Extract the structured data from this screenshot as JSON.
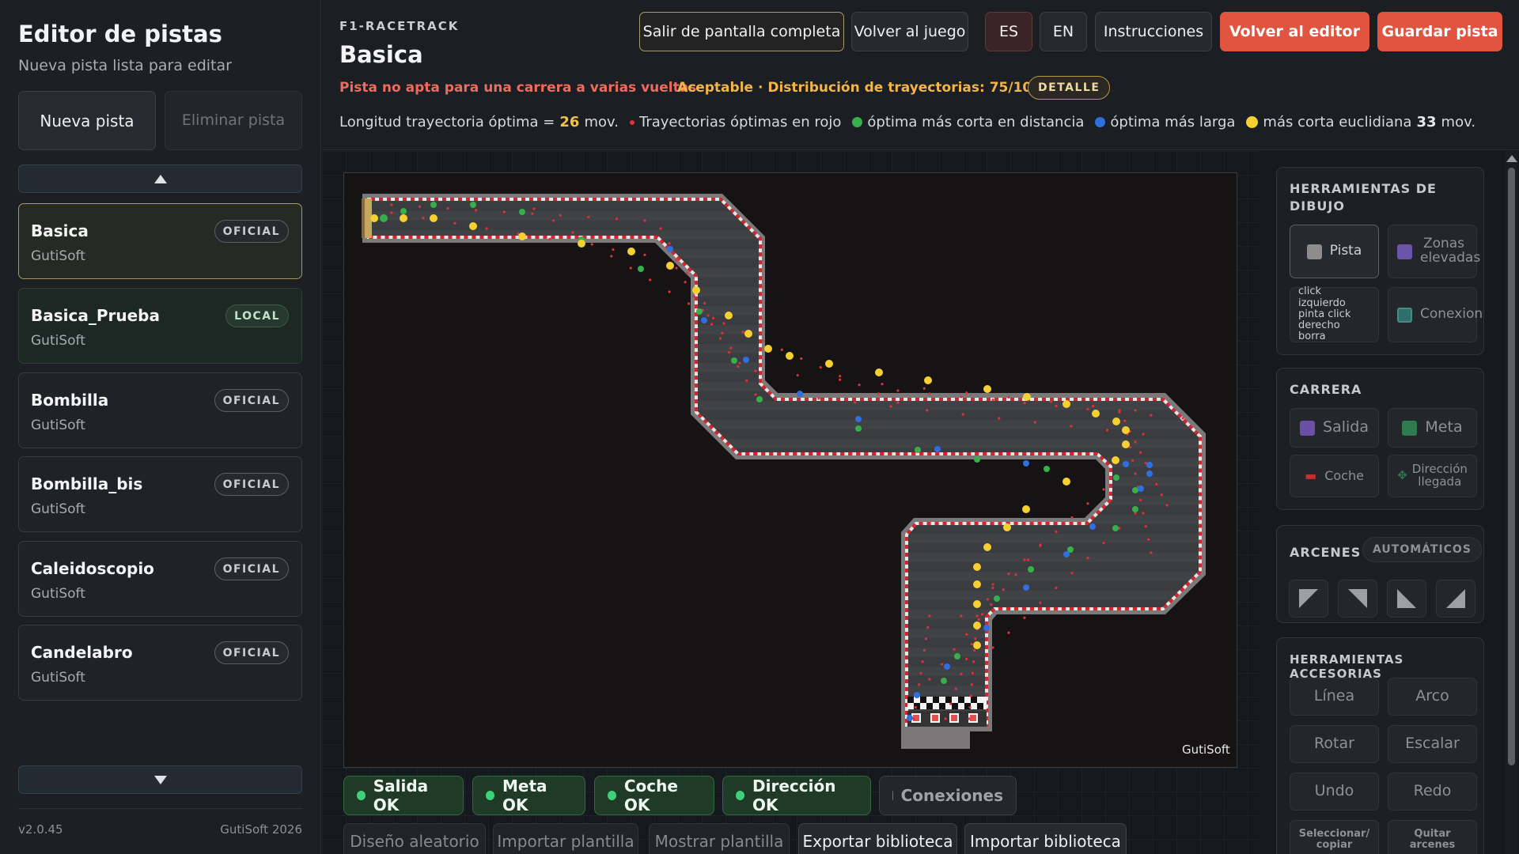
{
  "sidebar": {
    "title": "Editor de pistas",
    "subtitle": "Nueva pista lista para editar",
    "new_label": "Nueva pista",
    "delete_label": "Eliminar pista",
    "tracks": [
      {
        "name": "Basica",
        "author": "GutiSoft",
        "badge": "OFICIAL"
      },
      {
        "name": "Basica_Prueba",
        "author": "GutiSoft",
        "badge": "LOCAL"
      },
      {
        "name": "Bombilla",
        "author": "GutiSoft",
        "badge": "OFICIAL"
      },
      {
        "name": "Bombilla_bis",
        "author": "GutiSoft",
        "badge": "OFICIAL"
      },
      {
        "name": "Caleidoscopio",
        "author": "GutiSoft",
        "badge": "OFICIAL"
      },
      {
        "name": "Candelabro",
        "author": "GutiSoft",
        "badge": "OFICIAL"
      }
    ],
    "version": "v2.0.45",
    "copyright": "GutiSoft 2026"
  },
  "header": {
    "app": "F1-RACETRACK",
    "title": "Basica",
    "warning": "Pista no apta para una carrera a varias vueltas",
    "quality": "Aceptable · Distribución de trayectorias: 75/100",
    "detail": "DETALLE",
    "info": {
      "optimal_prefix": "Longitud trayectoria óptima =",
      "optimal_value": "26",
      "optimal_unit": "mov.",
      "red": "Trayectorias óptimas en rojo",
      "green": "óptima más corta en distancia",
      "blue": "óptima más larga",
      "yellow": "más corta euclidiana",
      "yellow_value": "33",
      "yellow_unit": "mov."
    },
    "buttons": {
      "exit_fullscreen": "Salir de pantalla completa",
      "back_game": "Volver al juego",
      "es": "ES",
      "en": "EN",
      "instructions": "Instrucciones",
      "back_editor": "Volver al editor",
      "save": "Guardar pista"
    }
  },
  "canvas": {
    "watermark": "GutiSoft"
  },
  "status": [
    {
      "label": "Salida OK",
      "ok": true
    },
    {
      "label": "Meta OK",
      "ok": true
    },
    {
      "label": "Coche OK",
      "ok": true
    },
    {
      "label": "Dirección OK",
      "ok": true
    },
    {
      "label": "Conexiones",
      "ok": false
    }
  ],
  "bottom_buttons": [
    {
      "label": "Diseño aleatorio"
    },
    {
      "label": "Importar plantilla"
    },
    {
      "label": "Mostrar plantilla"
    },
    {
      "label": "Exportar biblioteca"
    },
    {
      "label": "Importar biblioteca"
    }
  ],
  "right_panel": {
    "draw": {
      "title": "HERRAMIENTAS DE DIBUJO",
      "track": "Pista",
      "elevated": "Zonas elevadas",
      "hint": "click izquierdo pinta click derecho borra",
      "connection": "Conexion"
    },
    "race": {
      "title": "CARRERA",
      "start": "Salida",
      "finish": "Meta",
      "car": "Coche",
      "direction": "Dirección llegada"
    },
    "shoulders": {
      "title": "ARCENES",
      "auto": "AUTOMÁTICOS"
    },
    "tools": {
      "title": "HERRAMIENTAS ACCESORIAS",
      "line": "Línea",
      "arc": "Arco",
      "rotate": "Rotar",
      "scale": "Escalar",
      "undo": "Undo",
      "redo": "Redo",
      "select": "Seleccionar/ copiar",
      "remove": "Quitar arcenes"
    }
  },
  "colors": {
    "accent_red": "#e05440",
    "warning": "#ef6b5d",
    "quality": "#f2b54a",
    "ok_green": "#3fd07a",
    "path_red": "#e0303a",
    "path_green": "#35b04a",
    "path_blue": "#2f6fe0",
    "path_yellow": "#f5d030"
  }
}
